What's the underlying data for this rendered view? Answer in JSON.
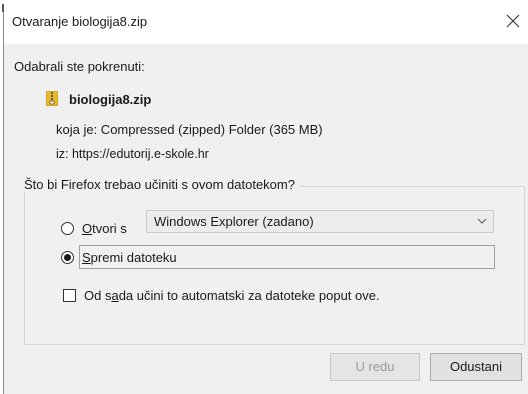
{
  "dialog": {
    "title": "Otvaranje biologija8.zip"
  },
  "intro": "Odabrali ste pokrenuti:",
  "file": {
    "name": "biologija8.zip",
    "type_line": "koja je: Compressed (zipped) Folder (365 MB)",
    "from_line": "iz: https://edutorij.e-skole.hr",
    "icon": "zip-folder-icon"
  },
  "question": "Što bi Firefox trebao učiniti s ovom datotekom?",
  "open_with": {
    "label_pre": "",
    "label_accel": "O",
    "label_post": "tvori s",
    "selected": false,
    "app": "Windows Explorer (zadano)"
  },
  "save_file": {
    "label_pre": "",
    "label_accel": "S",
    "label_post": "premi datoteku",
    "selected": true
  },
  "auto": {
    "label_pre": "Od s",
    "label_accel": "a",
    "label_post": "da učini to automatski za datoteke poput ove.",
    "checked": false
  },
  "buttons": {
    "ok": "U redu",
    "cancel": "Odustani"
  },
  "colors": {
    "dialog_bg": "#f0f0f0",
    "zip_icon": "#e8b830"
  }
}
